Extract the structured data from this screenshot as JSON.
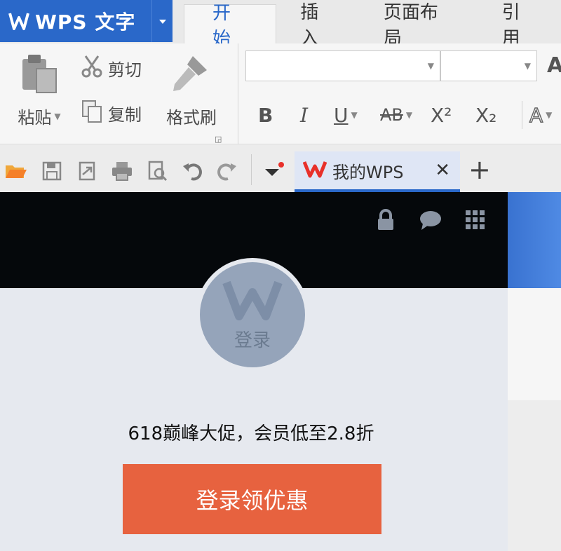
{
  "app": {
    "name": "WPS 文字"
  },
  "ribbon_tabs": [
    {
      "label": "开始",
      "active": true
    },
    {
      "label": "插入",
      "active": false
    },
    {
      "label": "页面布局",
      "active": false
    },
    {
      "label": "引用",
      "active": false
    }
  ],
  "clipboard": {
    "paste_label": "粘贴",
    "cut_label": "剪切",
    "copy_label": "复制",
    "format_painter_label": "格式刷"
  },
  "font": {
    "font_name": "",
    "font_size": "",
    "bold": "B",
    "italic": "I",
    "underline": "U",
    "strikethrough": "AB",
    "superscript": "X²",
    "subscript": "X₂",
    "text_effect": "A",
    "grow": "A"
  },
  "document_tab": {
    "label": "我的WPS"
  },
  "panel": {
    "avatar_label": "登录",
    "promo_text": "618巅峰大促，会员低至2.8折",
    "promo_button": "登录领优惠"
  },
  "colors": {
    "accent": "#2a68c9",
    "promo_button": "#e7623f",
    "header": "#05080b",
    "avatar": "#95a4ba",
    "wps_red": "#e8302a"
  }
}
